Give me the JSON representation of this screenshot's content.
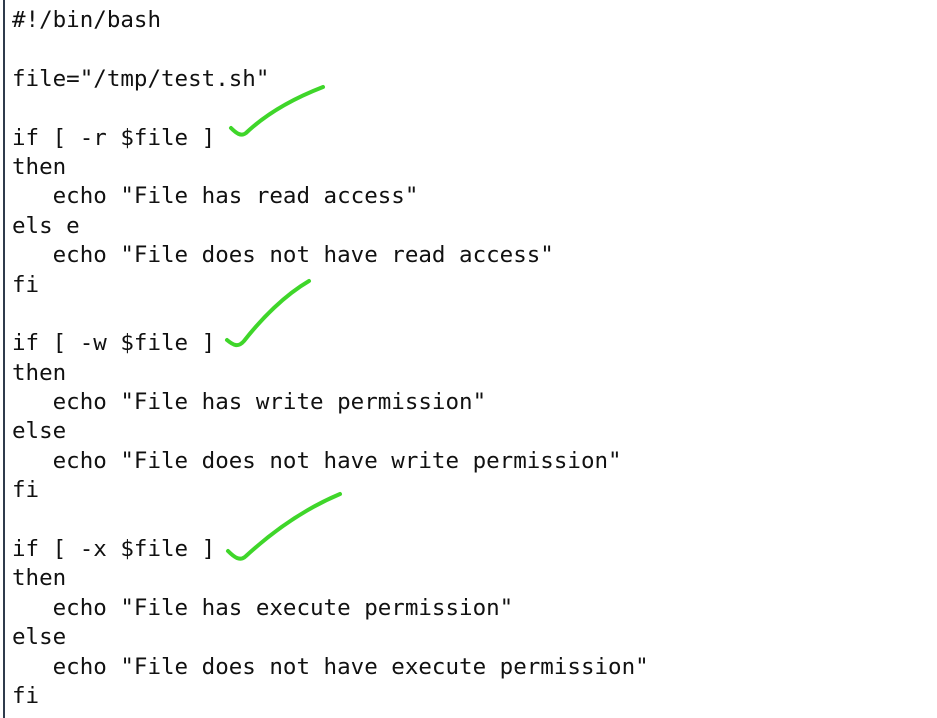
{
  "editor": {
    "lines": [
      "#!/bin/bash",
      "",
      "file=\"/tmp/test.sh\"",
      "",
      "if [ -r $file ]",
      "then",
      "   echo \"File has read access\"",
      "els e",
      "   echo \"File does not have read access\"",
      "fi",
      "",
      "if [ -w $file ]",
      "then",
      "   echo \"File has write permission\"",
      "else",
      "   echo \"File does not have write permission\"",
      "fi",
      "",
      "if [ -x $file ]",
      "then",
      "   echo \"File has execute permission\"",
      "else",
      "   echo \"File does not have execute permission\"",
      "fi"
    ]
  },
  "annotations": {
    "checkmark_color": "#3fd62a",
    "icon": "checkmark-icon"
  }
}
